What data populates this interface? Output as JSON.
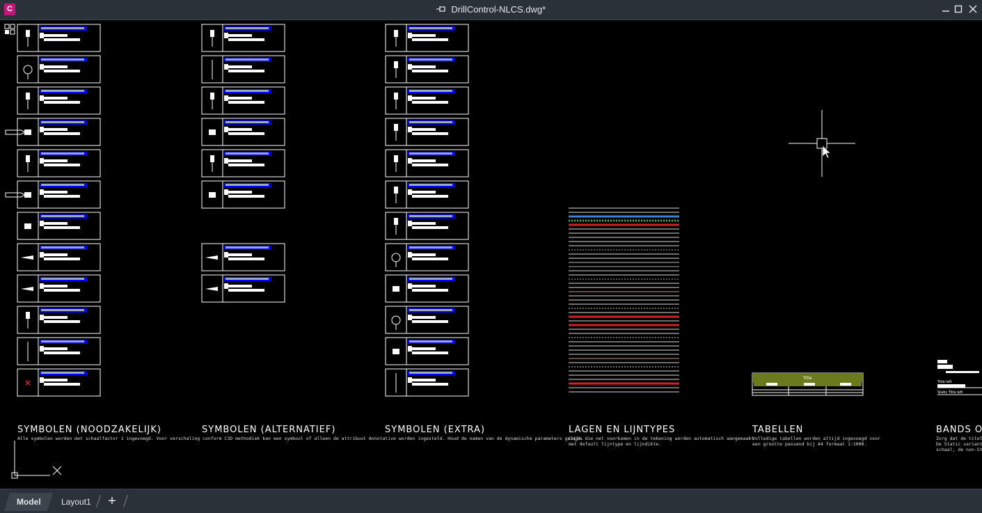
{
  "window": {
    "app_icon": "C",
    "title": "DrillControl-NLCS.dwg*",
    "pin_icon": "pin-icon",
    "min_icon": "minimize-icon",
    "max_icon": "maximize-icon",
    "close_icon": "close-icon"
  },
  "sections": [
    {
      "title": "SYMBOLEN (NOODZAKELIJK)",
      "desc": "Alle symbolen worden met schaalfactor 1 ingevoegd. Voor verschaling conform C3D methodiek kan een symbool of alleen de attribuut Annotative worden ingesteld. Houd de namen van de dynamische parameters gelijk."
    },
    {
      "title": "SYMBOLEN (ALTERNATIEF)",
      "desc": ""
    },
    {
      "title": "SYMBOLEN (EXTRA)",
      "desc": ""
    },
    {
      "title": "LAGEN EN LIJNTYPES",
      "desc": "Lagen die net voorkomen in de tekening worden automatisch aangemaakt\nmet default lijntype en lijndikte."
    },
    {
      "title": "TABELLEN",
      "desc": "Volledige tabellen worden altijd ingevoegd voor\neen grootte passend bij A4 formaat 1:1000."
    },
    {
      "title": "BANDS OB",
      "desc": "Zorg dat de titelbl\nDe Static variant w\nschaal, de non-Sta"
    }
  ],
  "table_block": {
    "header": "Title"
  },
  "bands_block": {
    "label1": "Title left",
    "label2": "Static Title left"
  },
  "tabs": {
    "model": "Model",
    "layout1": "Layout1",
    "add": "+"
  },
  "colors": {
    "titlebar": "#2b3138",
    "accent": "#c3187a",
    "highlight": "#0000ff",
    "table_header": "#6b7a1c"
  }
}
